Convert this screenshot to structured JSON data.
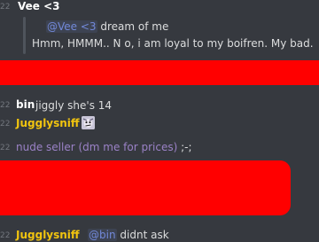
{
  "messages": {
    "vee": {
      "timestamp": "22",
      "author": "Vee <3",
      "quote_mention": "@Vee <3",
      "quote_text": "dream of me",
      "reply_text": "Hmm, HMMM.. N o, i am loyal to my boifren. My bad."
    },
    "bin": {
      "timestamp": "22",
      "author": "bin",
      "text": "jiggly she's 14"
    },
    "jugglysniff_1": {
      "timestamp": "22",
      "author": "Jugglysniff",
      "emoji": "confused-face-emoji"
    },
    "nude_seller": {
      "timestamp": "22",
      "text": "nude seller (dm me for prices)",
      "emote": ";-;"
    },
    "jugglysniff_2": {
      "timestamp": "22",
      "author": "Jugglysniff",
      "mention": "@bin",
      "text": "didnt ask"
    }
  },
  "colors": {
    "background": "#36393f",
    "redaction": "#ff0000",
    "gold_author": "#f1c40f",
    "mention": "#7289da",
    "purple_text": "#9b82c7"
  }
}
